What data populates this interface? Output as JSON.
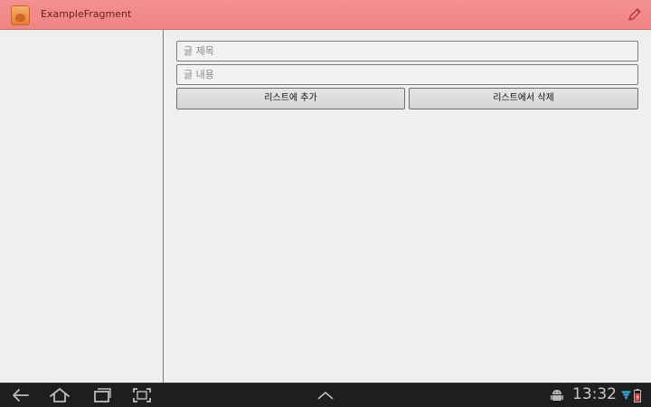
{
  "action_bar": {
    "app_title": "ExampleFragment",
    "app_icon": "app-icon",
    "edit_icon": "pencil-icon",
    "background_color": "#f08888"
  },
  "form": {
    "title_field": {
      "value": "",
      "placeholder": "글 제목"
    },
    "content_field": {
      "value": "",
      "placeholder": "글 내용"
    },
    "add_button_label": "리스트에 추가",
    "delete_button_label": "리스트에서 삭제"
  },
  "system_bar": {
    "nav_icons": [
      "back-icon",
      "home-icon",
      "recent-apps-icon",
      "screenshot-icon",
      "menu-up-icon"
    ],
    "status_icons": [
      "android-debug-icon",
      "wifi-icon",
      "battery-icon"
    ],
    "clock": "13:32",
    "background_color": "#1e1e1e",
    "accent_color": "#33b5e5"
  }
}
